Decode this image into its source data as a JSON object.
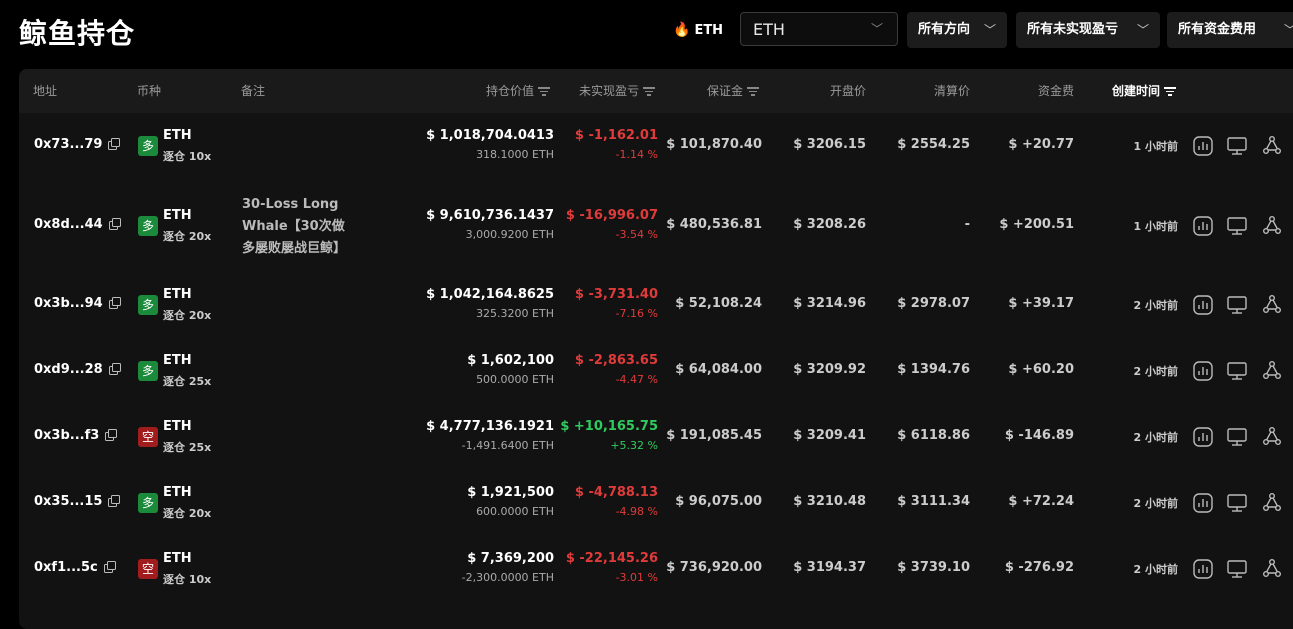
{
  "page": {
    "title": "鲸鱼持仓"
  },
  "filters": {
    "coin_tag": "ETH",
    "coin_select": "ETH",
    "direction": "所有方向",
    "unrealized": "所有未实现盈亏",
    "funding": "所有资金费用"
  },
  "table": {
    "headers": {
      "address": "地址",
      "coin": "币种",
      "note": "备注",
      "position_value": "持仓价值",
      "unrealized_pnl": "未实现盈亏",
      "margin": "保证金",
      "entry_price": "开盘价",
      "liq_price": "清算价",
      "funding": "资金费",
      "created": "创建时间"
    },
    "rows": [
      {
        "address": "0x73...79",
        "side": "多",
        "side_type": "long",
        "coin": "ETH",
        "leverage": "逐仓 10x",
        "note": "",
        "value": "$ 1,018,704.0413",
        "size": "318.1000 ETH",
        "pnl": "$ -1,162.01",
        "pnl_pct": "-1.14 %",
        "pnl_type": "red",
        "margin": "$ 101,870.40",
        "entry": "$ 3206.15",
        "liq": "$ 2554.25",
        "funding": "$ +20.77",
        "funding_type": "green",
        "time": "1 小时前"
      },
      {
        "address": "0x8d...44",
        "side": "多",
        "side_type": "long",
        "coin": "ETH",
        "leverage": "逐仓 20x",
        "note": "30-Loss Long Whale【30次做多屡败屡战巨鲸】",
        "value": "$ 9,610,736.1437",
        "size": "3,000.9200 ETH",
        "pnl": "$ -16,996.07",
        "pnl_pct": "-3.54 %",
        "pnl_type": "red",
        "margin": "$ 480,536.81",
        "entry": "$ 3208.26",
        "liq": "-",
        "funding": "$ +200.51",
        "funding_type": "green",
        "time": "1 小时前"
      },
      {
        "address": "0x3b...94",
        "side": "多",
        "side_type": "long",
        "coin": "ETH",
        "leverage": "逐仓 20x",
        "note": "",
        "value": "$ 1,042,164.8625",
        "size": "325.3200 ETH",
        "pnl": "$ -3,731.40",
        "pnl_pct": "-7.16 %",
        "pnl_type": "red",
        "margin": "$ 52,108.24",
        "entry": "$ 3214.96",
        "liq": "$ 2978.07",
        "funding": "$ +39.17",
        "funding_type": "green",
        "time": "2 小时前"
      },
      {
        "address": "0xd9...28",
        "side": "多",
        "side_type": "long",
        "coin": "ETH",
        "leverage": "逐仓 25x",
        "note": "",
        "value": "$ 1,602,100",
        "size": "500.0000 ETH",
        "pnl": "$ -2,863.65",
        "pnl_pct": "-4.47 %",
        "pnl_type": "red",
        "margin": "$ 64,084.00",
        "entry": "$ 3209.92",
        "liq": "$ 1394.76",
        "funding": "$ +60.20",
        "funding_type": "green",
        "time": "2 小时前"
      },
      {
        "address": "0x3b...f3",
        "side": "空",
        "side_type": "short",
        "coin": "ETH",
        "leverage": "逐仓 25x",
        "note": "",
        "value": "$ 4,777,136.1921",
        "size": "-1,491.6400 ETH",
        "pnl": "$ +10,165.75",
        "pnl_pct": "+5.32 %",
        "pnl_type": "green",
        "margin": "$ 191,085.45",
        "entry": "$ 3209.41",
        "liq": "$ 6118.86",
        "funding": "$ -146.89",
        "funding_type": "red",
        "time": "2 小时前"
      },
      {
        "address": "0x35...15",
        "side": "多",
        "side_type": "long",
        "coin": "ETH",
        "leverage": "逐仓 20x",
        "note": "",
        "value": "$ 1,921,500",
        "size": "600.0000 ETH",
        "pnl": "$ -4,788.13",
        "pnl_pct": "-4.98 %",
        "pnl_type": "red",
        "margin": "$ 96,075.00",
        "entry": "$ 3210.48",
        "liq": "$ 3111.34",
        "funding": "$ +72.24",
        "funding_type": "green",
        "time": "2 小时前"
      },
      {
        "address": "0xf1...5c",
        "side": "空",
        "side_type": "short",
        "coin": "ETH",
        "leverage": "逐仓 10x",
        "note": "",
        "value": "$ 7,369,200",
        "size": "-2,300.0000 ETH",
        "pnl": "$ -22,145.26",
        "pnl_pct": "-3.01 %",
        "pnl_type": "red",
        "margin": "$ 736,920.00",
        "entry": "$ 3194.37",
        "liq": "$ 3739.10",
        "funding": "$ -276.92",
        "funding_type": "red",
        "time": "2 小时前"
      }
    ]
  }
}
